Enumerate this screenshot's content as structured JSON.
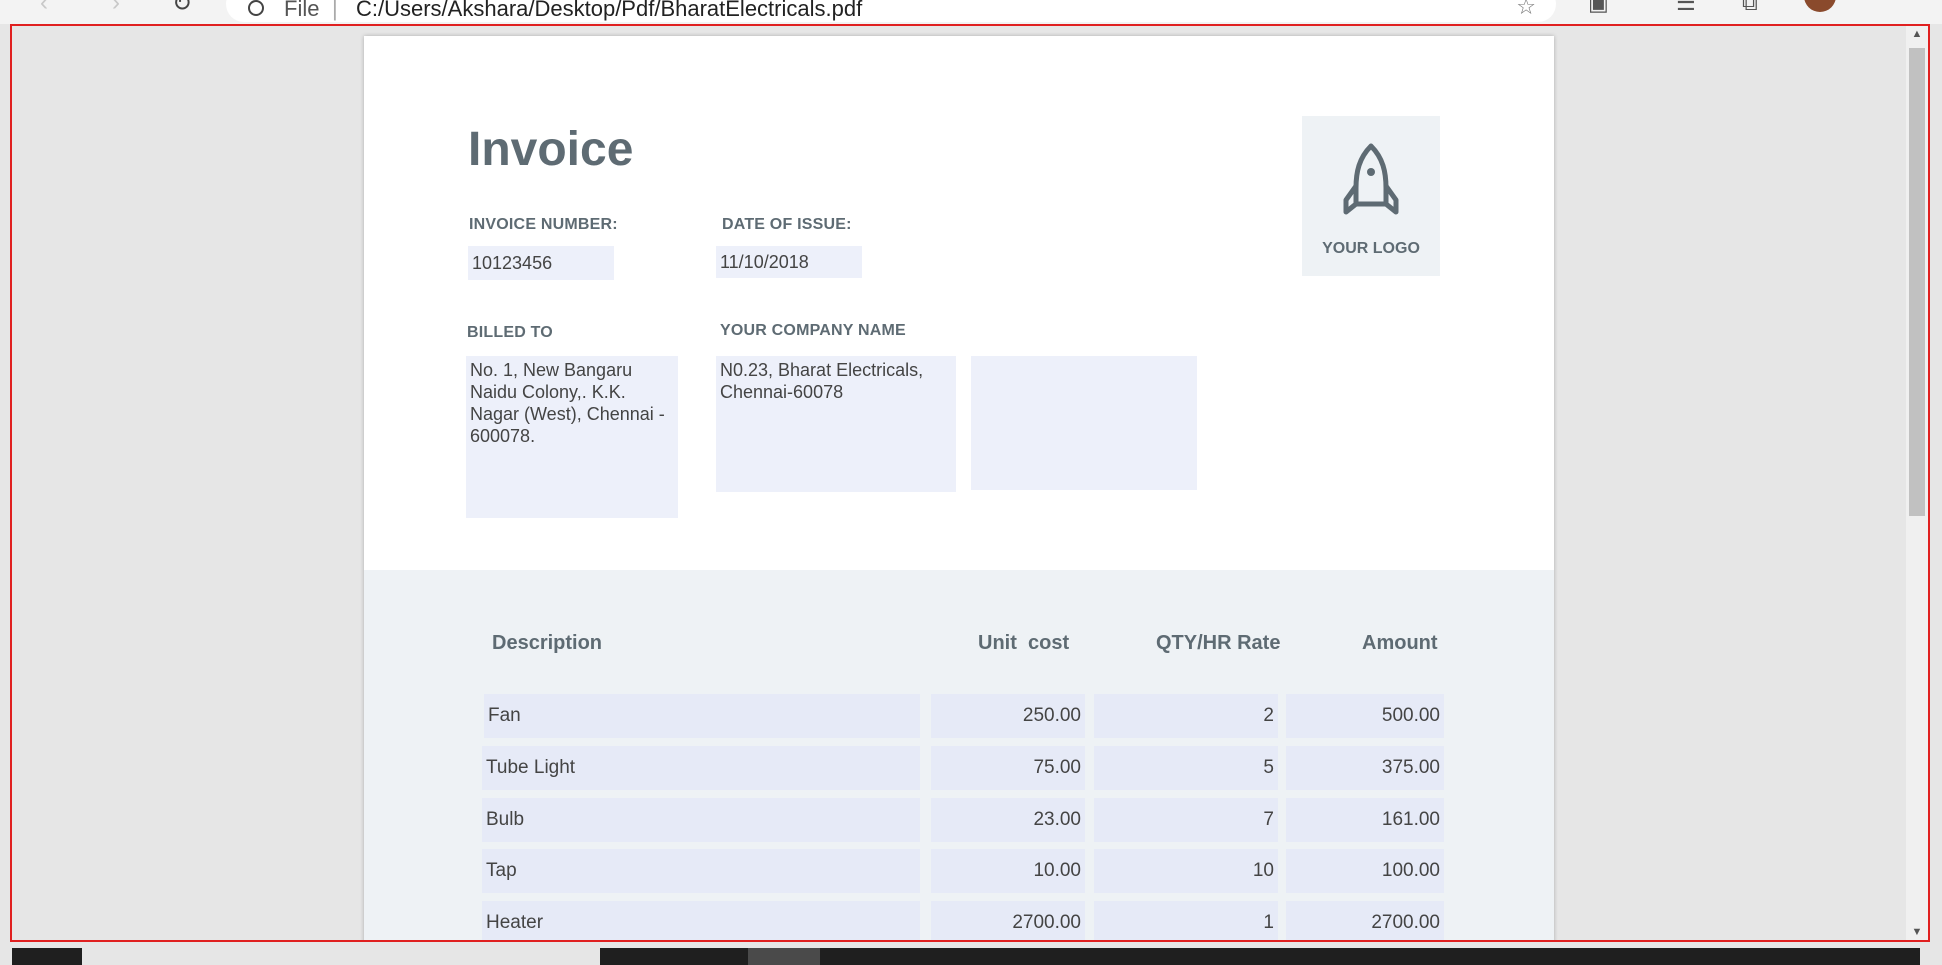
{
  "browser": {
    "address_label": "File",
    "address_separator": "|",
    "url": "C:/Users/Akshara/Desktop/Pdf/BharatElectricals.pdf"
  },
  "invoice": {
    "title": "Invoice",
    "invoice_number_label": "INVOICE NUMBER:",
    "invoice_number": "10123456",
    "date_label": "DATE OF ISSUE:",
    "date": "11/10/2018",
    "billed_to_label": "BILLED TO",
    "billed_to_address": "No. 1, New Bangaru Naidu Colony,. K.K. Nagar (West), Chennai - 600078.",
    "company_label": "YOUR COMPANY NAME",
    "company_address": "N0.23, Bharat Electricals, Chennai-60078",
    "company_extra": "",
    "logo_text": "YOUR LOGO"
  },
  "table": {
    "headers": [
      "Description",
      "Unit  cost",
      "QTY/HR Rate",
      "Amount"
    ],
    "rows": [
      {
        "description": "Fan",
        "unit_cost": "250.00",
        "qty": "2",
        "amount": "500.00"
      },
      {
        "description": "Tube Light",
        "unit_cost": "75.00",
        "qty": "5",
        "amount": "375.00"
      },
      {
        "description": "Bulb",
        "unit_cost": "23.00",
        "qty": "7",
        "amount": "161.00"
      },
      {
        "description": "Tap",
        "unit_cost": "10.00",
        "qty": "10",
        "amount": "100.00"
      },
      {
        "description": "Heater",
        "unit_cost": "2700.00",
        "qty": "1",
        "amount": "2700.00"
      }
    ]
  }
}
